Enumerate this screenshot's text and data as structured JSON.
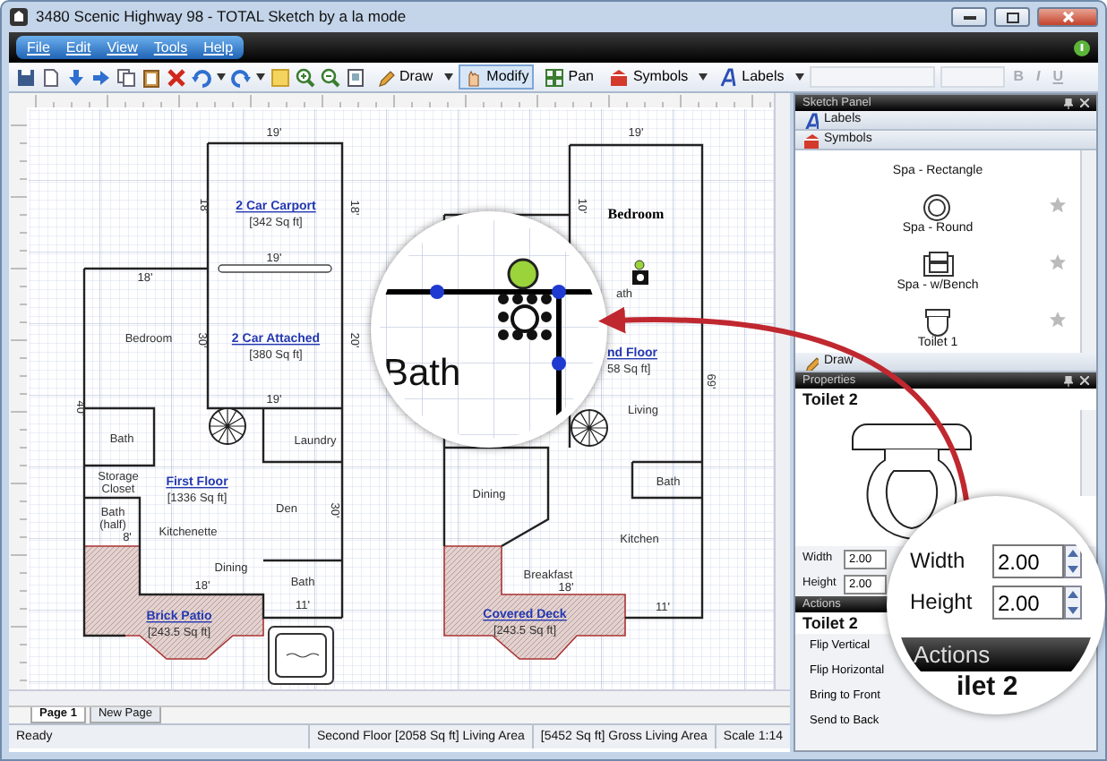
{
  "window": {
    "title": "3480 Scenic Highway 98 - TOTAL Sketch by a la mode"
  },
  "menu": [
    {
      "label": "File"
    },
    {
      "label": "Edit"
    },
    {
      "label": "View"
    },
    {
      "label": "Tools"
    },
    {
      "label": "Help"
    }
  ],
  "toolbar": {
    "tools": [
      {
        "label": "Draw",
        "kind": "dropdown",
        "selected": false
      },
      {
        "label": "Modify",
        "kind": "button",
        "selected": true
      },
      {
        "label": "Pan",
        "kind": "button",
        "selected": false
      },
      {
        "label": "Symbols",
        "kind": "dropdown",
        "selected": false
      },
      {
        "label": "Labels",
        "kind": "dropdown",
        "selected": false
      }
    ],
    "format_buttons": [
      {
        "label": "B",
        "disabled": true
      },
      {
        "label": "I",
        "disabled": true
      },
      {
        "label": "U",
        "disabled": true
      }
    ]
  },
  "plans": [
    {
      "labels": [
        {
          "kind": "dim",
          "text": "19'"
        },
        {
          "kind": "vdim",
          "text": "18'"
        },
        {
          "kind": "area",
          "text": "2 Car Carport"
        },
        {
          "kind": "size",
          "text": "[342 Sq ft]"
        },
        {
          "kind": "vdim",
          "text": "18'"
        },
        {
          "kind": "dim",
          "text": "19'"
        },
        {
          "kind": "dim",
          "text": "18'"
        },
        {
          "kind": "room",
          "text": "Bedroom"
        },
        {
          "kind": "vdim",
          "text": "30'"
        },
        {
          "kind": "area",
          "text": "2 Car Attached"
        },
        {
          "kind": "size",
          "text": "[380 Sq ft]"
        },
        {
          "kind": "vdim",
          "text": "20'"
        },
        {
          "kind": "vdim",
          "text": "40'"
        },
        {
          "kind": "dim",
          "text": "19'"
        },
        {
          "kind": "room",
          "text": "Bath"
        },
        {
          "kind": "room",
          "text": "Laundry"
        },
        {
          "kind": "room",
          "text": "Storage"
        },
        {
          "kind": "room",
          "text": "Closet"
        },
        {
          "kind": "area",
          "text": "First Floor"
        },
        {
          "kind": "size",
          "text": "[1336 Sq ft]"
        },
        {
          "kind": "room",
          "text": "Den"
        },
        {
          "kind": "vdim",
          "text": "30'"
        },
        {
          "kind": "room",
          "text": "Bath"
        },
        {
          "kind": "room",
          "text": "(half)"
        },
        {
          "kind": "dim",
          "text": "8'"
        },
        {
          "kind": "room",
          "text": "Kitchenette"
        },
        {
          "kind": "room",
          "text": "Dining"
        },
        {
          "kind": "dim",
          "text": "18'"
        },
        {
          "kind": "room",
          "text": "Bath"
        },
        {
          "kind": "dim",
          "text": "11'"
        },
        {
          "kind": "area",
          "text": "Brick Patio"
        },
        {
          "kind": "size",
          "text": "[243.5 Sq ft]"
        }
      ]
    },
    {
      "labels": [
        {
          "kind": "dim",
          "text": "19'"
        },
        {
          "kind": "vdim",
          "text": "10'"
        },
        {
          "kind": "heading",
          "text": "Bedroom"
        },
        {
          "kind": "room",
          "text": "ath"
        },
        {
          "kind": "area",
          "text": "nd Floor"
        },
        {
          "kind": "size",
          "text": "58 Sq ft]"
        },
        {
          "kind": "vdim",
          "text": "69'"
        },
        {
          "kind": "room",
          "text": "Living"
        },
        {
          "kind": "room",
          "text": "Bath"
        },
        {
          "kind": "room",
          "text": "Dining"
        },
        {
          "kind": "room",
          "text": "Kitchen"
        },
        {
          "kind": "room",
          "text": "Breakfast"
        },
        {
          "kind": "dim",
          "text": "18'"
        },
        {
          "kind": "dim",
          "text": "11'"
        },
        {
          "kind": "area",
          "text": "Covered Deck"
        },
        {
          "kind": "size",
          "text": "[243.5 Sq ft]"
        }
      ]
    }
  ],
  "magnifiers": [
    {
      "label": "Bath"
    },
    {
      "fields": [
        {
          "label": "Width",
          "value": "2.00"
        },
        {
          "label": "Height",
          "value": "2.00"
        }
      ],
      "header": "Actions",
      "title": "ilet 2"
    }
  ],
  "sketch_panel": {
    "title": "Sketch Panel",
    "sections": [
      {
        "label": "Labels"
      },
      {
        "label": "Symbols"
      }
    ],
    "symbols": [
      {
        "name": "Spa - Rectangle"
      },
      {
        "name": "Spa - Round"
      },
      {
        "name": "Spa - w/Bench"
      },
      {
        "name": "Toilet 1"
      }
    ],
    "footer": "Draw"
  },
  "properties": {
    "title": "Properties",
    "item": "Toilet 2",
    "fields": [
      {
        "label": "Width",
        "value": "2.00"
      },
      {
        "label": "Height",
        "value": "2.00"
      }
    ]
  },
  "actions": {
    "title": "Actions",
    "item": "Toilet 2",
    "items": [
      "Flip Vertical",
      "Flip Horizontal",
      "Bring to Front",
      "Send to Back"
    ]
  },
  "page_tabs": [
    {
      "label": "Page 1",
      "selected": true
    },
    {
      "label": "New Page",
      "selected": false
    }
  ],
  "status_bar": [
    "Ready",
    "Second Floor  [2058 Sq ft]  Living Area",
    "[5452 Sq ft]  Gross Living Area",
    "Scale 1:14"
  ]
}
